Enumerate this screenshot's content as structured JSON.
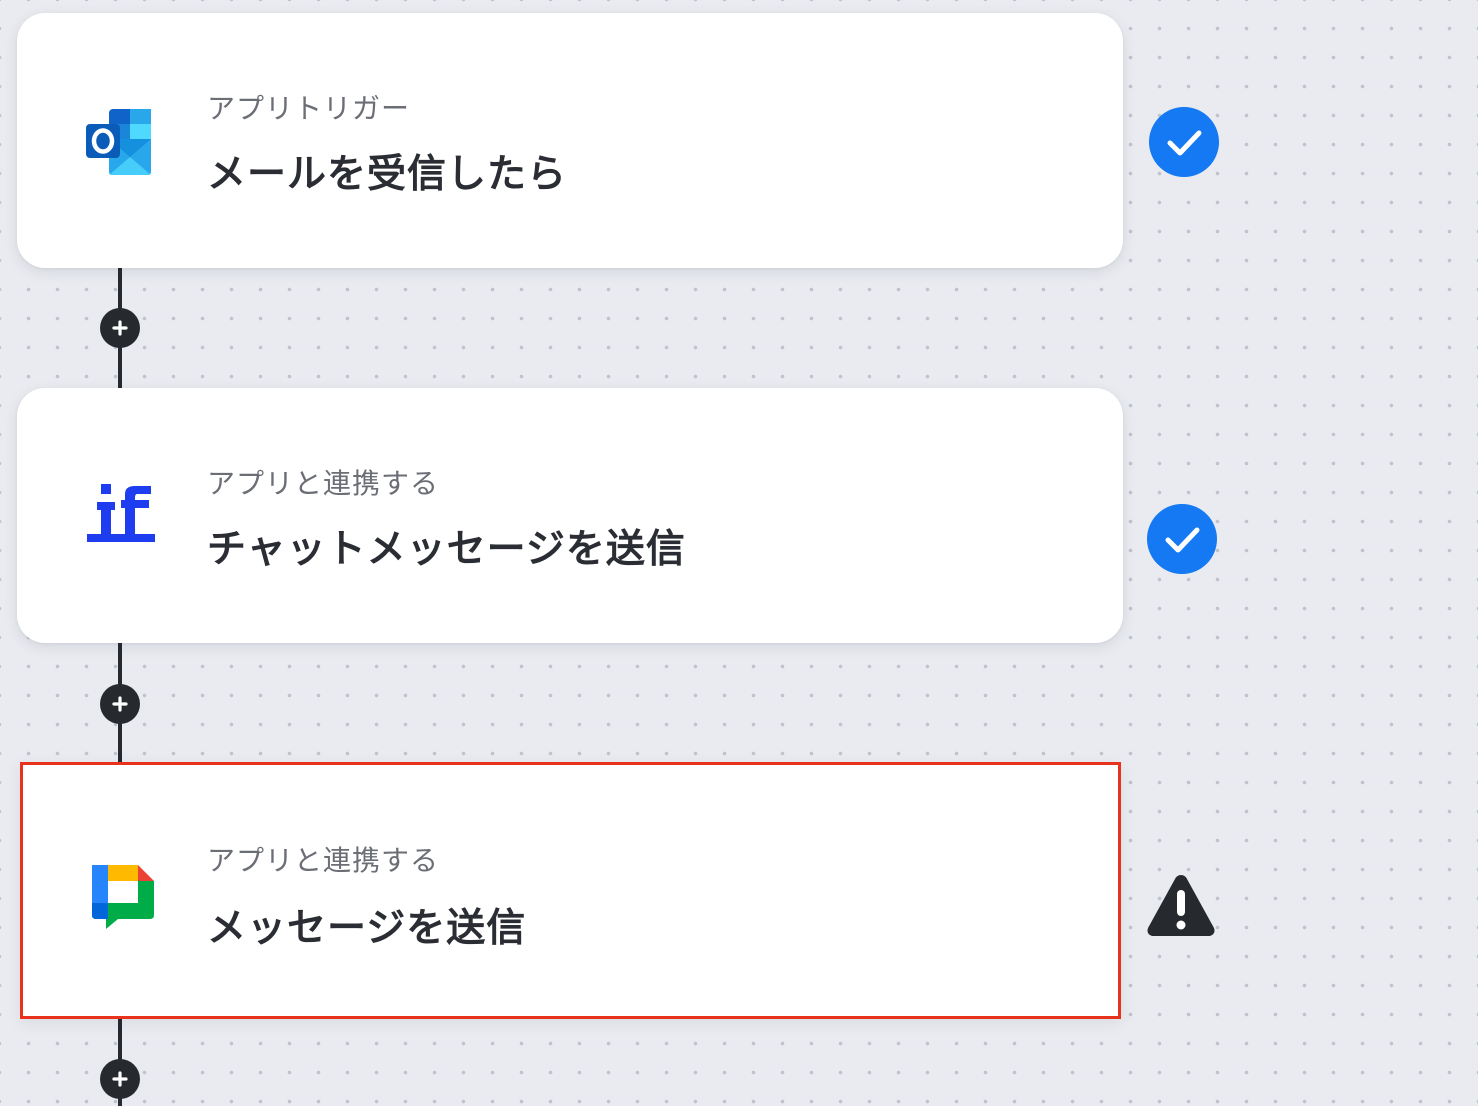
{
  "colors": {
    "canvas": "#e9ebf0",
    "card": "#ffffff",
    "selected_border": "#e8321c",
    "check_badge": "#1479f2",
    "warning": "#26292e",
    "connector": "#26292e"
  },
  "steps": [
    {
      "app_icon": "outlook-icon",
      "subtitle": "アプリトリガー",
      "title": "メールを受信したら",
      "status": "check-icon"
    },
    {
      "app_icon": "if-branch-icon",
      "subtitle": "アプリと連携する",
      "title": "チャットメッセージを送信",
      "status": "check-icon"
    },
    {
      "app_icon": "google-chat-icon",
      "subtitle": "アプリと連携する",
      "title": "メッセージを送信",
      "status": "warning-icon",
      "selected": true
    }
  ],
  "add_button_icon": "plus-icon"
}
